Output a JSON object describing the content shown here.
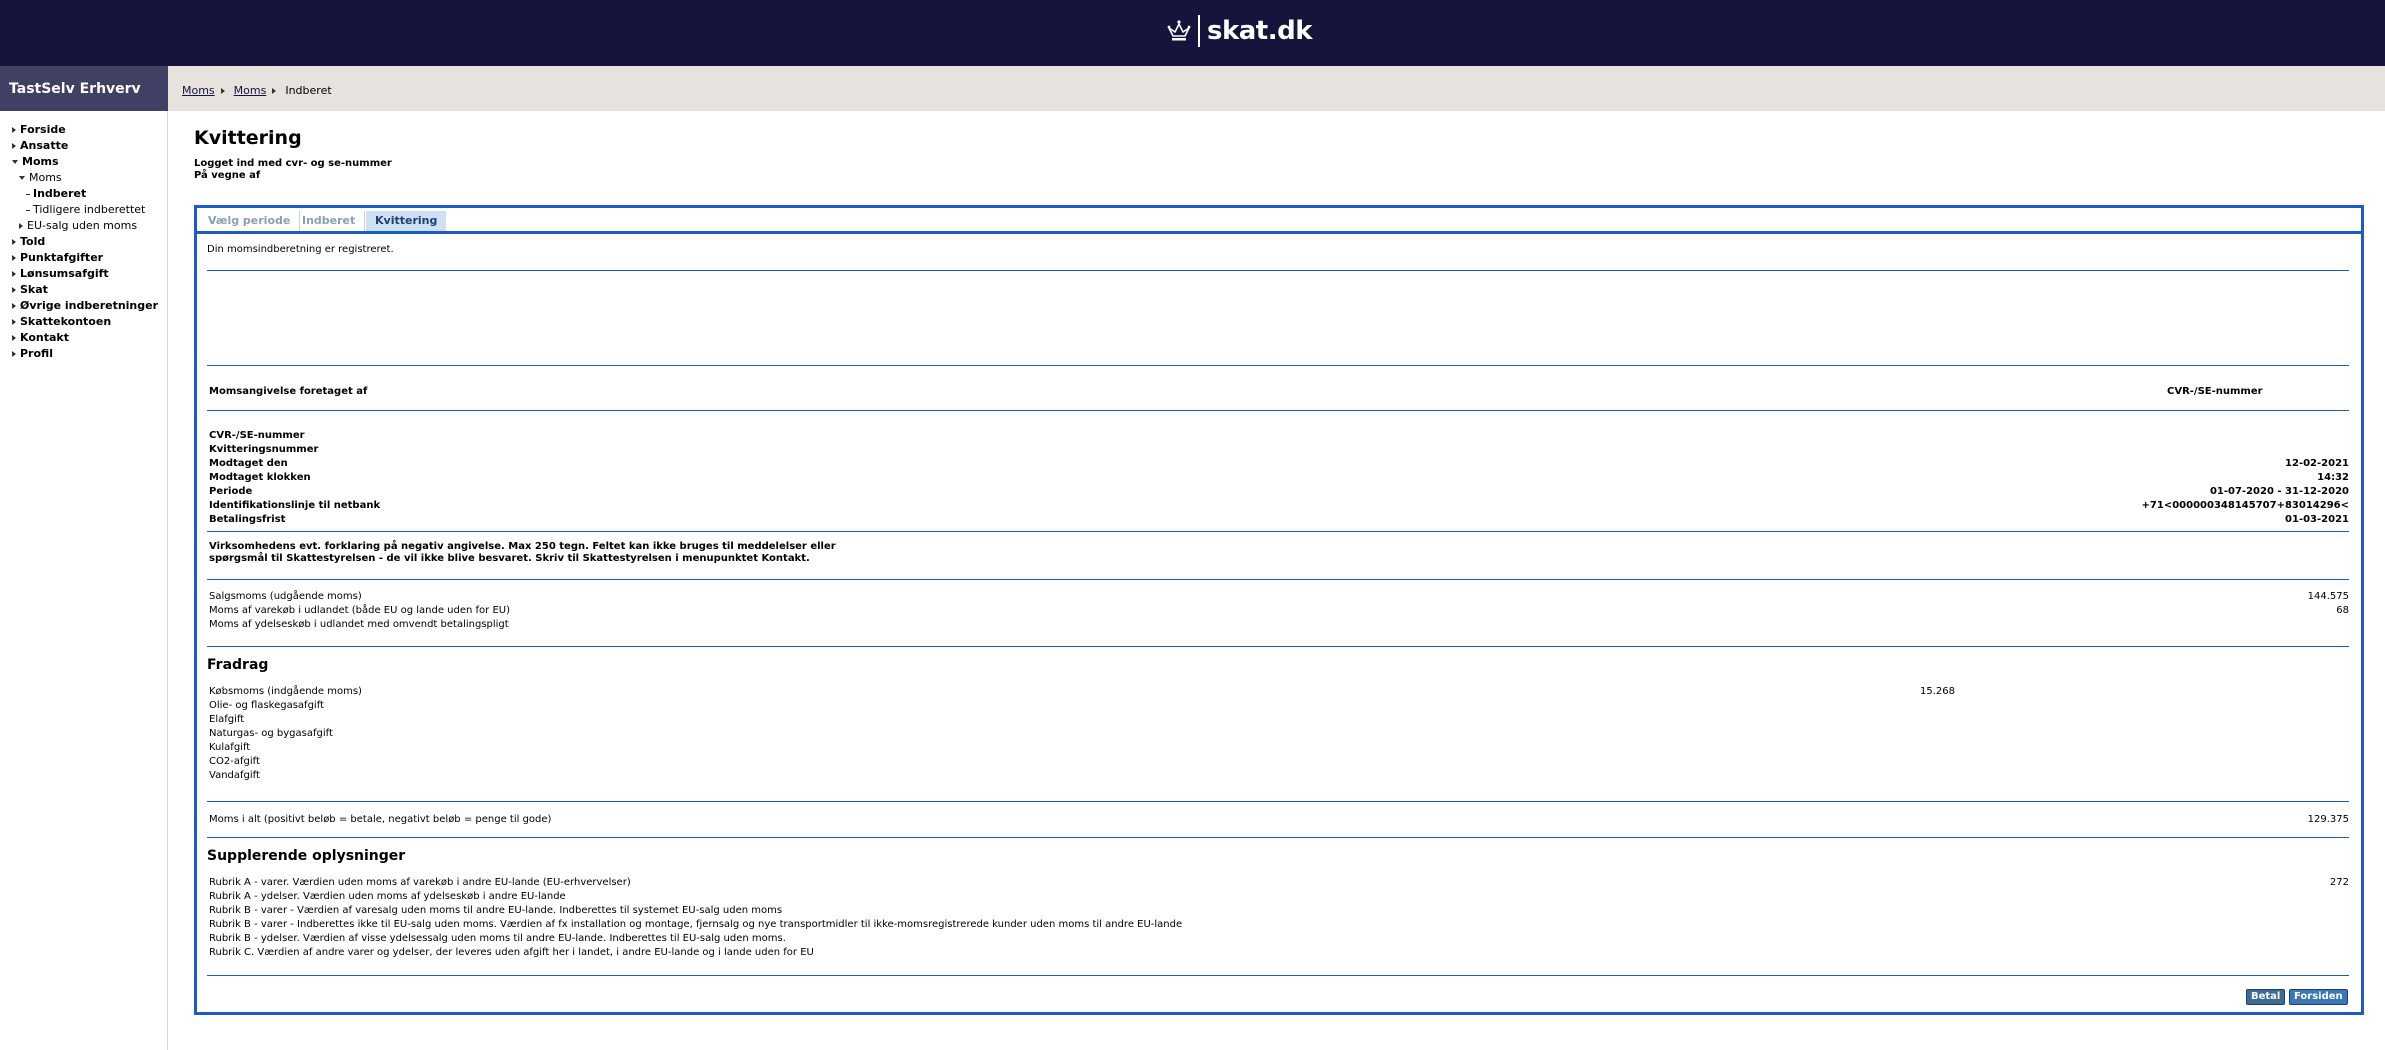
{
  "header": {
    "brand": "skat.dk",
    "crown_icon": "crown-icon"
  },
  "sidebar": {
    "title": "TastSelv Erhverv",
    "items": [
      {
        "label": "Forside",
        "bold": true,
        "marker": "tri-r",
        "indent": 0
      },
      {
        "label": "Ansatte",
        "bold": true,
        "marker": "tri-r",
        "indent": 0
      },
      {
        "label": "Moms",
        "bold": true,
        "marker": "tri-d",
        "indent": 0
      },
      {
        "label": "Moms",
        "bold": false,
        "marker": "tri-d",
        "indent": 1
      },
      {
        "label": "Indberet",
        "bold": true,
        "marker": "dash",
        "indent": 2
      },
      {
        "label": "Tidligere indberettet",
        "bold": false,
        "marker": "dash",
        "indent": 2
      },
      {
        "label": "EU-salg uden moms",
        "bold": false,
        "marker": "tri-r",
        "indent": 1
      },
      {
        "label": "Told",
        "bold": true,
        "marker": "tri-r",
        "indent": 0
      },
      {
        "label": "Punktafgifter",
        "bold": true,
        "marker": "tri-r",
        "indent": 0
      },
      {
        "label": "Lønsumsafgift",
        "bold": true,
        "marker": "tri-r",
        "indent": 0
      },
      {
        "label": "Skat",
        "bold": true,
        "marker": "tri-r",
        "indent": 0
      },
      {
        "label": "Øvrige indberetninger",
        "bold": true,
        "marker": "tri-r",
        "indent": 0
      },
      {
        "label": "Skattekontoen",
        "bold": true,
        "marker": "tri-r",
        "indent": 0
      },
      {
        "label": "Kontakt",
        "bold": true,
        "marker": "tri-r",
        "indent": 0
      },
      {
        "label": "Profil",
        "bold": true,
        "marker": "tri-r",
        "indent": 0
      }
    ]
  },
  "breadcrumb": {
    "items": [
      "Moms",
      "Moms"
    ],
    "current": "Indberet"
  },
  "page": {
    "title": "Kvittering",
    "login_line1": "Logget ind med cvr- og se-nummer",
    "login_line2": "På vegne af"
  },
  "tabs": [
    "Vælg periode",
    "Indberet",
    "Kvittering"
  ],
  "receipt": {
    "status": "Din momsindberetning er registreret.",
    "made_by_label": "Momsangivelse foretaget af",
    "cvr_header": "CVR-/SE-nummer",
    "details": [
      {
        "label": "CVR-/SE-nummer",
        "value": ""
      },
      {
        "label": "Kvitteringsnummer",
        "value": ""
      },
      {
        "label": "Modtaget den",
        "value": "12-02-2021"
      },
      {
        "label": "Modtaget klokken",
        "value": "14:32"
      },
      {
        "label": "Periode",
        "value": "01-07-2020 - 31-12-2020"
      },
      {
        "label": "Identifikationslinje til netbank",
        "value": "+71<000000348145707+83014296<"
      },
      {
        "label": "Betalingsfrist",
        "value": "01-03-2021"
      }
    ],
    "explain_line1": "Virksomhedens evt. forklaring på negativ angivelse. Max 250 tegn. Feltet kan ikke bruges til meddelelser eller",
    "explain_line2": "spørgsmål til Skattestyrelsen - de vil ikke blive besvaret. Skriv til Skattestyrelsen i menupunktet Kontakt.",
    "sales": [
      {
        "label": "Salgsmoms (udgående moms)",
        "value": "144.575"
      },
      {
        "label": "Moms af varekøb i udlandet (både EU og lande uden for EU)",
        "value": "68"
      },
      {
        "label": "Moms af ydelseskøb i udlandet med omvendt betalingspligt",
        "value": ""
      }
    ],
    "fradrag_title": "Fradrag",
    "fradrag": [
      {
        "label": "Købsmoms (indgående moms)",
        "value": "15.268"
      },
      {
        "label": "Olie- og flaskegasafgift",
        "value": ""
      },
      {
        "label": "Elafgift",
        "value": ""
      },
      {
        "label": "Naturgas- og bygasafgift",
        "value": ""
      },
      {
        "label": "Kulafgift",
        "value": ""
      },
      {
        "label": "CO2-afgift",
        "value": ""
      },
      {
        "label": "Vandafgift",
        "value": ""
      }
    ],
    "total": {
      "label": "Moms i alt (positivt beløb = betale, negativt beløb = penge til gode)",
      "value": "129.375"
    },
    "supp_title": "Supplerende oplysninger",
    "supp": [
      {
        "label": "Rubrik A - varer. Værdien uden moms af varekøb i andre EU-lande (EU-erhvervelser)",
        "value": "272"
      },
      {
        "label": "Rubrik A - ydelser. Værdien uden moms af ydelseskøb i andre EU-lande",
        "value": ""
      },
      {
        "label": "Rubrik B - varer - Værdien af varesalg uden moms til andre EU-lande. Indberettes til systemet EU-salg uden moms",
        "value": ""
      },
      {
        "label": "Rubrik B - varer - Indberettes ikke til EU-salg uden moms. Værdien af fx installation og montage, fjernsalg og nye transportmidler til ikke-momsregistrerede kunder uden moms til andre EU-lande",
        "value": ""
      },
      {
        "label": "Rubrik B - ydelser. Værdien af visse ydelsessalg uden moms til andre EU-lande. Indberettes til EU-salg uden moms.",
        "value": ""
      },
      {
        "label": "Rubrik C. Værdien af andre varer og ydelser, der leveres uden afgift her i landet, i andre EU-lande og i lande uden for EU",
        "value": ""
      }
    ]
  },
  "buttons": {
    "pay": "Betal",
    "home": "Forsiden"
  },
  "colors": {
    "topbar": "#14143c",
    "accent": "#1e5bc6",
    "sidebar_head": "#3f4063",
    "button": "#3c6b94"
  }
}
